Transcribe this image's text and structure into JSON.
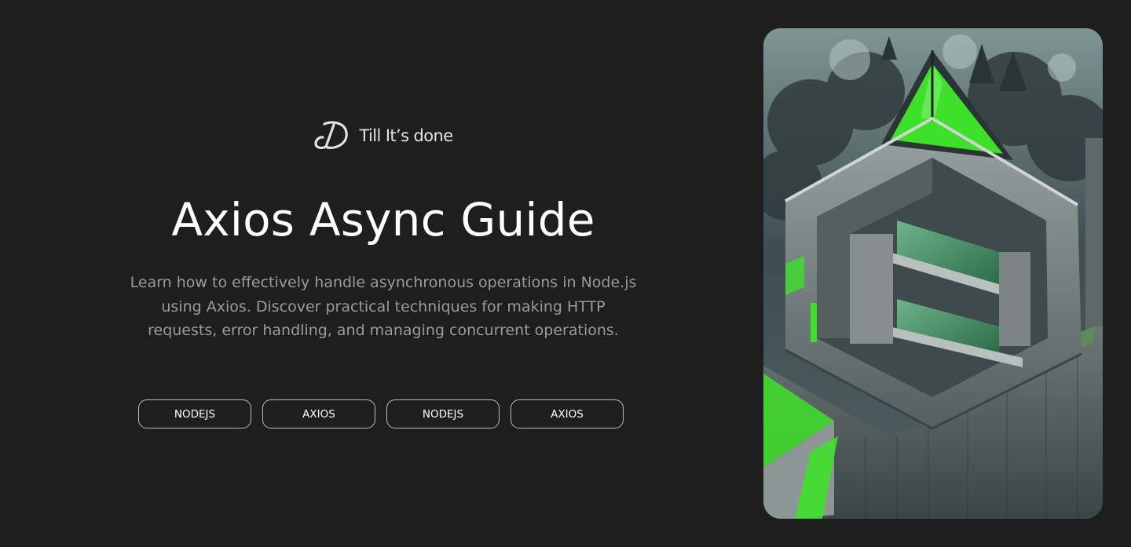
{
  "brand": {
    "name": "Till It’s done",
    "logo_icon": "d-monogram-logo"
  },
  "hero": {
    "title": "Axios Async Guide",
    "description": "Learn how to effectively handle asynchronous operations in Node.js using Axios. Discover practical techniques for making HTTP requests, error handling, and managing concurrent operations."
  },
  "tags": [
    {
      "label": "NODEJS"
    },
    {
      "label": "AXIOS"
    },
    {
      "label": "NODEJS"
    },
    {
      "label": "AXIOS"
    }
  ],
  "image": {
    "subject": "brutalist-concrete-architecture-with-green-glass"
  },
  "colors": {
    "background": "#1e1e1e",
    "accent_green": "#3fe02a"
  }
}
